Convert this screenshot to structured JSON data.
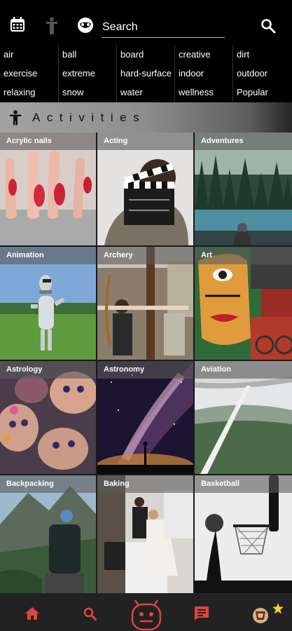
{
  "search": {
    "placeholder": "Search"
  },
  "tags": [
    [
      "air",
      "ball",
      "board",
      "creative",
      "dirt"
    ],
    [
      "exercise",
      "extreme",
      "hard-surface",
      "indoor",
      "outdoor"
    ],
    [
      "relaxing",
      "snow",
      "water",
      "wellness",
      "Popular"
    ]
  ],
  "section": {
    "title": "Activities"
  },
  "activities": [
    {
      "label": "Acrylic nails"
    },
    {
      "label": "Acting"
    },
    {
      "label": "Adventures"
    },
    {
      "label": "Animation"
    },
    {
      "label": "Archery"
    },
    {
      "label": "Art"
    },
    {
      "label": "Astrology"
    },
    {
      "label": "Astronomy"
    },
    {
      "label": "Aviation"
    },
    {
      "label": "Backpacking"
    },
    {
      "label": "Baking"
    },
    {
      "label": "Basketball"
    }
  ],
  "colors": {
    "accent": "#e0453f",
    "star": "#f2d22e",
    "background": "#1a1a1a"
  },
  "icons": {
    "topbar": [
      "calendar-icon",
      "person-standing-icon",
      "face-mask-icon",
      "search-icon"
    ],
    "section": "person-icon",
    "bottom": [
      "home-icon",
      "search-icon",
      "robot-icon",
      "chat-icon",
      "avatar-badge",
      "star-icon"
    ]
  }
}
